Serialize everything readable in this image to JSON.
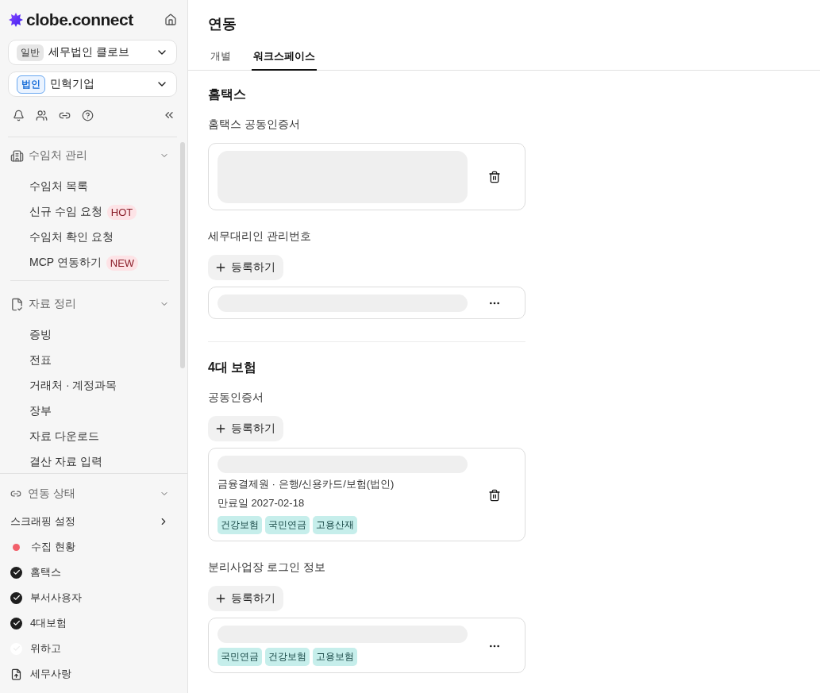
{
  "sidebar": {
    "brand": "clobe.connect",
    "selectors": [
      {
        "badge": "일반",
        "label": "세무법인 클로브"
      },
      {
        "badge": "법인",
        "label": "민혁기업"
      }
    ],
    "groups": [
      {
        "title": "수임처 관리",
        "expanded": true,
        "items": [
          {
            "label": "수임처 목록"
          },
          {
            "label": "신규 수임 요청",
            "tag": "HOT"
          },
          {
            "label": "수임처 확인 요청"
          },
          {
            "label": "MCP 연동하기",
            "tag": "NEW"
          }
        ]
      },
      {
        "title": "자료 정리",
        "expanded": true,
        "items": [
          {
            "label": "증빙"
          },
          {
            "label": "전표"
          },
          {
            "label": "거래처 · 계정과목"
          },
          {
            "label": "장부"
          },
          {
            "label": "자료 다운로드"
          },
          {
            "label": "결산 자료 입력"
          }
        ]
      }
    ],
    "status": {
      "title": "연동 상태",
      "expanded": true,
      "settings": "스크래핑 설정",
      "items": [
        {
          "kind": "dot",
          "label": "수집 현황",
          "color": "#f2606b"
        },
        {
          "kind": "check",
          "label": "홈택스",
          "checked": true
        },
        {
          "kind": "check",
          "label": "부서사용자",
          "checked": true
        },
        {
          "kind": "check",
          "label": "4대보험",
          "checked": true
        },
        {
          "kind": "check",
          "label": "위하고",
          "checked": false
        },
        {
          "kind": "file",
          "label": "세무사랑"
        }
      ]
    }
  },
  "page": {
    "title": "연동",
    "tabs": [
      {
        "label": "개별",
        "selected": false
      },
      {
        "label": "워크스페이스",
        "selected": true
      }
    ],
    "sections": [
      {
        "title": "홈택스",
        "blocks": [
          {
            "label": "홈택스 공동인증서",
            "card": {
              "kind": "certificate"
            }
          },
          {
            "label": "세무대리인 관리번호",
            "add": "등록하기",
            "card": {
              "kind": "login"
            }
          }
        ]
      },
      {
        "title": "4대 보험",
        "blocks": [
          {
            "label": "공동인증서",
            "add": "등록하기",
            "card": {
              "kind": "certificate",
              "lines": [
                "금융결제원 · 은행/신용카드/보험(법인)",
                "만료일 2027-02-18"
              ],
              "tags": [
                "건강보험",
                "국민연금",
                "고용산재"
              ]
            }
          },
          {
            "label": "분리사업장 로그인 정보",
            "add": "등록하기",
            "card": {
              "kind": "login",
              "tags": [
                "국민연금",
                "건강보험",
                "고용보험"
              ]
            }
          }
        ]
      }
    ]
  }
}
